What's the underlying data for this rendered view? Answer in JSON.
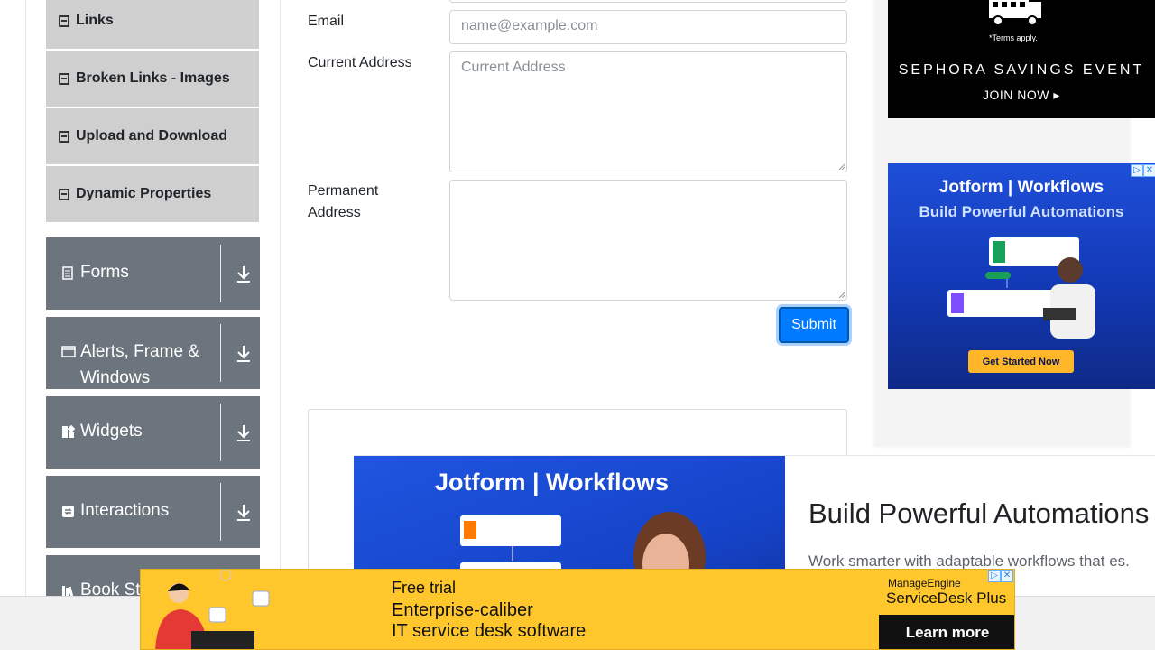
{
  "sidebar": {
    "sub_items": [
      {
        "label": "Links"
      },
      {
        "label": "Broken Links - Images"
      },
      {
        "label": "Upload and Download"
      },
      {
        "label": "Dynamic Properties"
      }
    ],
    "groups": [
      {
        "label": "Forms",
        "icon": "document-icon"
      },
      {
        "label": "Alerts, Frame & Windows",
        "icon": "window-icon"
      },
      {
        "label": "Widgets",
        "icon": "widgets-icon"
      },
      {
        "label": "Interactions",
        "icon": "interactions-icon"
      },
      {
        "label": "Book St",
        "icon": "books-icon"
      }
    ]
  },
  "form": {
    "email_label": "Email",
    "email_placeholder": "name@example.com",
    "current_address_label": "Current Address",
    "current_address_placeholder": "Current Address",
    "permanent_address_label": "Permanent Address",
    "submit_label": "Submit"
  },
  "ads": {
    "sephora": {
      "terms": "*Terms apply.",
      "event": "SEPHORA SAVINGS EVENT",
      "cta": "JOIN NOW ▸"
    },
    "jotform_side": {
      "brand": "Jotform | Workflows",
      "headline": "Build Powerful Automations",
      "cta": "Get Started Now"
    },
    "jotform_big": {
      "brand": "Jotform | Workflows",
      "title": "Build Powerful Automations",
      "description": "Work smarter with adaptable workflows that es."
    },
    "banner": {
      "line1": "Free trial",
      "line2": "Enterprise-caliber",
      "line3": "IT service desk software",
      "brand_small": "ManageEngine",
      "brand_product": "ServiceDesk Plus",
      "cta": "Learn more"
    }
  },
  "colors": {
    "primary": "#007bff",
    "sidebar_group": "#6c757d",
    "sidebar_sub": "#cfcfcf",
    "banner_yellow": "#ffc72c",
    "jotform_blue": "#1e4fd8"
  }
}
